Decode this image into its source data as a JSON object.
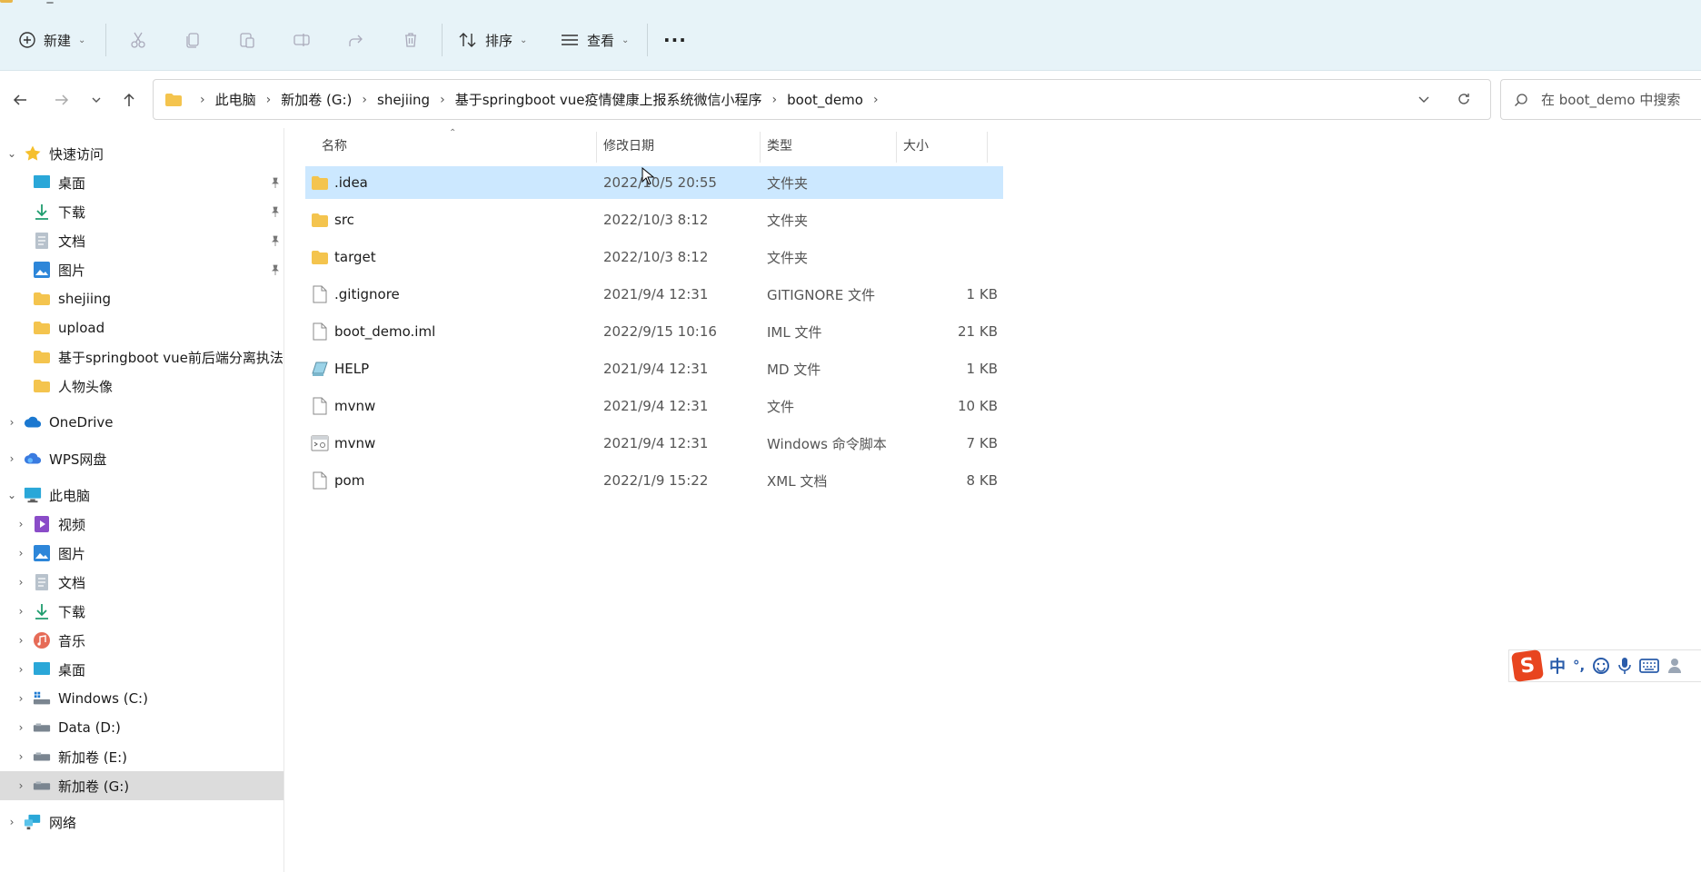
{
  "window": {
    "title": "boot_demo"
  },
  "toolbar": {
    "new_label": "新建",
    "sort_label": "排序",
    "view_label": "查看",
    "more_label": "···",
    "icons": [
      "cut-icon",
      "copy-icon",
      "paste-icon",
      "rename-icon",
      "share-icon",
      "delete-icon"
    ]
  },
  "address": {
    "crumbs": [
      "此电脑",
      "新加卷 (G:)",
      "shejiing",
      "基于springboot vue疫情健康上报系统微信小程序",
      "boot_demo"
    ]
  },
  "search": {
    "placeholder": "在 boot_demo 中搜索"
  },
  "sidebar": {
    "quick_access": "快速访问",
    "quick_items": [
      {
        "label": "桌面",
        "icon": "desktop-icon",
        "pinned": true
      },
      {
        "label": "下载",
        "icon": "download-icon",
        "pinned": true
      },
      {
        "label": "文档",
        "icon": "document-icon",
        "pinned": true
      },
      {
        "label": "图片",
        "icon": "picture-icon",
        "pinned": true
      },
      {
        "label": "shejiing",
        "icon": "folder-icon",
        "pinned": false
      },
      {
        "label": "upload",
        "icon": "folder-icon",
        "pinned": false
      },
      {
        "label": "基于springboot vue前后端分离执法",
        "icon": "folder-icon",
        "pinned": false
      },
      {
        "label": "人物头像",
        "icon": "folder-icon",
        "pinned": false
      }
    ],
    "onedrive": "OneDrive",
    "wps": "WPS网盘",
    "this_pc": "此电脑",
    "pc_items": [
      {
        "label": "视频",
        "icon": "video-icon"
      },
      {
        "label": "图片",
        "icon": "picture-icon"
      },
      {
        "label": "文档",
        "icon": "document-icon"
      },
      {
        "label": "下载",
        "icon": "download-icon"
      },
      {
        "label": "音乐",
        "icon": "music-icon"
      },
      {
        "label": "桌面",
        "icon": "desktop-icon"
      },
      {
        "label": "Windows (C:)",
        "icon": "drive-icon"
      },
      {
        "label": "Data (D:)",
        "icon": "drive-icon"
      },
      {
        "label": "新加卷 (E:)",
        "icon": "drive-icon"
      },
      {
        "label": "新加卷 (G:)",
        "icon": "drive-icon"
      }
    ],
    "network": "网络"
  },
  "columns": {
    "name": "名称",
    "date": "修改日期",
    "type": "类型",
    "size": "大小"
  },
  "files": [
    {
      "name": ".idea",
      "date": "2022/10/5 20:55",
      "type": "文件夹",
      "size": "",
      "icon": "folder-icon"
    },
    {
      "name": "src",
      "date": "2022/10/3 8:12",
      "type": "文件夹",
      "size": "",
      "icon": "folder-icon"
    },
    {
      "name": "target",
      "date": "2022/10/3 8:12",
      "type": "文件夹",
      "size": "",
      "icon": "folder-icon"
    },
    {
      "name": ".gitignore",
      "date": "2021/9/4 12:31",
      "type": "GITIGNORE 文件",
      "size": "1 KB",
      "icon": "file-icon"
    },
    {
      "name": "boot_demo.iml",
      "date": "2022/9/15 10:16",
      "type": "IML 文件",
      "size": "21 KB",
      "icon": "file-icon"
    },
    {
      "name": "HELP",
      "date": "2021/9/4 12:31",
      "type": "MD 文件",
      "size": "1 KB",
      "icon": "markdown-file-icon"
    },
    {
      "name": "mvnw",
      "date": "2021/9/4 12:31",
      "type": "文件",
      "size": "10 KB",
      "icon": "file-icon"
    },
    {
      "name": "mvnw",
      "date": "2021/9/4 12:31",
      "type": "Windows 命令脚本",
      "size": "7 KB",
      "icon": "script-file-icon"
    },
    {
      "name": "pom",
      "date": "2022/1/9 15:22",
      "type": "XML 文档",
      "size": "8 KB",
      "icon": "file-icon"
    }
  ],
  "ime": {
    "mode": "中",
    "punct": "°,"
  },
  "colors": {
    "toolbar_bg": "#e7f3f8",
    "selection": "#cce8ff",
    "sidebar_selected": "#dcdcdc",
    "folder": "#f4c44e",
    "ime_logo": "#e8451f"
  }
}
